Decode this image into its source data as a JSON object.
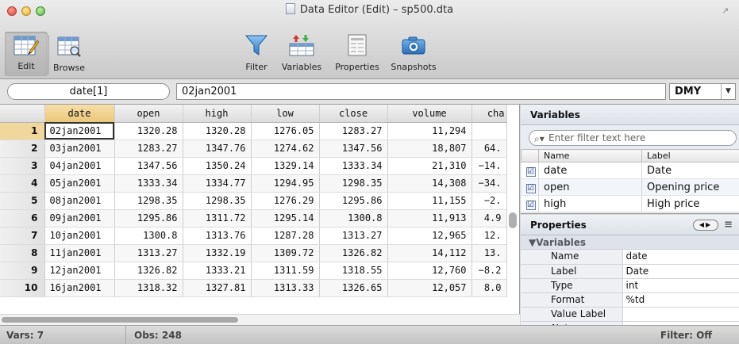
{
  "window": {
    "title": "Data Editor (Edit) – sp500.dta"
  },
  "toolbar": {
    "edit_label": "Edit",
    "browse_label": "Browse",
    "filter_label": "Filter",
    "variables_label": "Variables",
    "properties_label": "Properties",
    "snapshots_label": "Snapshots"
  },
  "formula": {
    "cell_ref": "date[1]",
    "cell_value": "02jan2001",
    "format_select": "DMY"
  },
  "grid": {
    "columns": [
      "date",
      "open",
      "high",
      "low",
      "close",
      "volume",
      "cha"
    ],
    "rows": [
      {
        "n": "1",
        "date": "02jan2001",
        "open": "1320.28",
        "high": "1320.28",
        "low": "1276.05",
        "close": "1283.27",
        "volume": "11,294",
        "change": ""
      },
      {
        "n": "2",
        "date": "03jan2001",
        "open": "1283.27",
        "high": "1347.76",
        "low": "1274.62",
        "close": "1347.56",
        "volume": "18,807",
        "change": "64."
      },
      {
        "n": "3",
        "date": "04jan2001",
        "open": "1347.56",
        "high": "1350.24",
        "low": "1329.14",
        "close": "1333.34",
        "volume": "21,310",
        "change": "−14."
      },
      {
        "n": "4",
        "date": "05jan2001",
        "open": "1333.34",
        "high": "1334.77",
        "low": "1294.95",
        "close": "1298.35",
        "volume": "14,308",
        "change": "−34."
      },
      {
        "n": "5",
        "date": "08jan2001",
        "open": "1298.35",
        "high": "1298.35",
        "low": "1276.29",
        "close": "1295.86",
        "volume": "11,155",
        "change": "−2."
      },
      {
        "n": "6",
        "date": "09jan2001",
        "open": "1295.86",
        "high": "1311.72",
        "low": "1295.14",
        "close": "1300.8",
        "volume": "11,913",
        "change": "4.9"
      },
      {
        "n": "7",
        "date": "10jan2001",
        "open": "1300.8",
        "high": "1313.76",
        "low": "1287.28",
        "close": "1313.27",
        "volume": "12,965",
        "change": "12."
      },
      {
        "n": "8",
        "date": "11jan2001",
        "open": "1313.27",
        "high": "1332.19",
        "low": "1309.72",
        "close": "1326.82",
        "volume": "14,112",
        "change": "13."
      },
      {
        "n": "9",
        "date": "12jan2001",
        "open": "1326.82",
        "high": "1333.21",
        "low": "1311.59",
        "close": "1318.55",
        "volume": "12,760",
        "change": "−8.2"
      },
      {
        "n": "10",
        "date": "16jan2001",
        "open": "1318.32",
        "high": "1327.81",
        "low": "1313.33",
        "close": "1326.65",
        "volume": "12,057",
        "change": "8.0"
      }
    ]
  },
  "variables_pane": {
    "title": "Variables",
    "filter_placeholder": "Enter filter text here",
    "col_name": "Name",
    "col_label": "Label",
    "items": [
      {
        "name": "date",
        "label": "Date",
        "checked": "☑"
      },
      {
        "name": "open",
        "label": "Opening price",
        "checked": "☑"
      },
      {
        "name": "high",
        "label": "High price",
        "checked": "☑"
      }
    ]
  },
  "properties_pane": {
    "title": "Properties",
    "group": "▼Variables",
    "rows": [
      {
        "key": "Name",
        "value": "date"
      },
      {
        "key": "Label",
        "value": "Date"
      },
      {
        "key": "Type",
        "value": "int"
      },
      {
        "key": "Format",
        "value": "%td"
      },
      {
        "key": "Value Label",
        "value": ""
      },
      {
        "key": "▶ Notes",
        "value": ""
      }
    ]
  },
  "status": {
    "vars": "Vars: 7",
    "obs": "Obs: 248",
    "filter": "Filter: Off"
  },
  "colors": {
    "selected_header": "#eac77a",
    "accent_blue": "#3a8fd6"
  }
}
